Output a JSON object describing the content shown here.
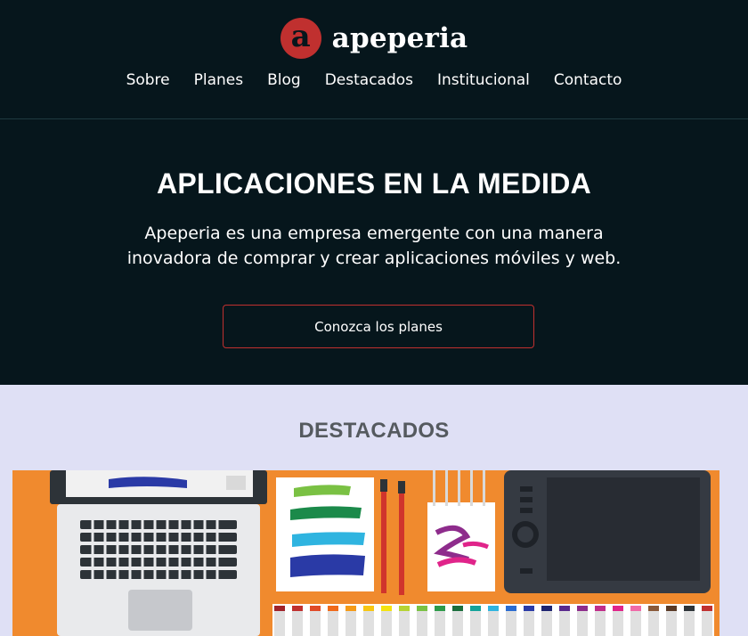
{
  "brand": {
    "name": "apeperia",
    "mark_letter": "a",
    "color": "#c0302f"
  },
  "nav": [
    "Sobre",
    "Planes",
    "Blog",
    "Destacados",
    "Institucional",
    "Contacto"
  ],
  "hero": {
    "title": "APLICACIONES EN LA MEDIDA",
    "description": "Apeperia es una empresa emergente con una manera inovadora de comprar y crear aplicaciones móviles y web.",
    "cta_label": "Conozca los planes"
  },
  "featured": {
    "title": "DESTACADOS"
  },
  "colors": {
    "header_bg": "#06161c",
    "section_bg": "#dfe0f5",
    "accent": "#c0302f",
    "illustration_bg": "#f08a2e"
  }
}
